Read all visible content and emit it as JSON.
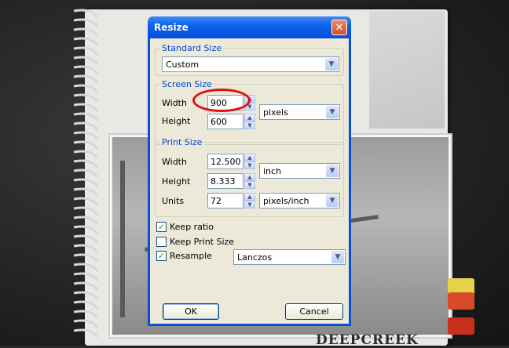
{
  "dialog": {
    "title": "Resize",
    "close_glyph": "✕",
    "standard_size": {
      "legend": "Standard Size",
      "selected": "Custom"
    },
    "screen_size": {
      "legend": "Screen Size",
      "width_label": "Width",
      "width_value": "900",
      "height_label": "Height",
      "height_value": "600",
      "unit": "pixels"
    },
    "print_size": {
      "legend": "Print Size",
      "width_label": "Width",
      "width_value": "12.500",
      "height_label": "Height",
      "height_value": "8.333",
      "unit": "inch",
      "units_label": "Units",
      "units_value": "72",
      "units_unit": "pixels/inch"
    },
    "options": {
      "keep_ratio": {
        "label": "Keep ratio",
        "checked": true
      },
      "keep_print_size": {
        "label": "Keep Print Size",
        "checked": false
      },
      "resample": {
        "label": "Resample",
        "checked": true,
        "method": "Lanczos"
      }
    },
    "ok_label": "OK",
    "cancel_label": "Cancel"
  },
  "background": {
    "brand_text": "DEEPCREEK"
  },
  "icons": {
    "dropdown": "chevron-down-icon",
    "spin_up": "arrow-up-icon",
    "spin_down": "arrow-down-icon",
    "check": "check-icon",
    "close": "close-icon"
  },
  "colors": {
    "title_bar": "#0a5fe8",
    "legend_text": "#0046d5",
    "highlight_ring": "#e01010",
    "dialog_face": "#ece9d8"
  }
}
